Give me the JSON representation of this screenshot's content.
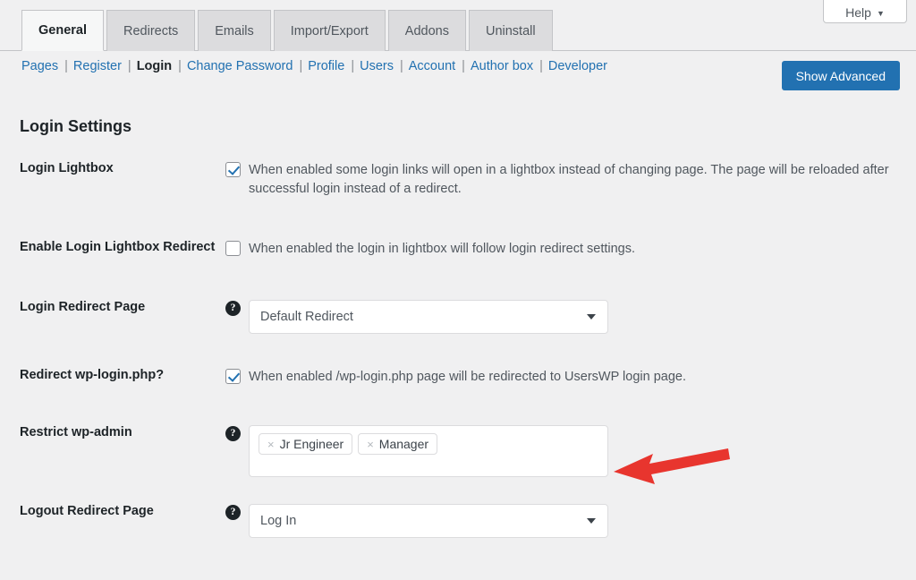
{
  "header": {
    "help_button": {
      "label": "Help",
      "caret": "▼"
    },
    "tabs": [
      {
        "label": "General",
        "active": true
      },
      {
        "label": "Redirects",
        "active": false
      },
      {
        "label": "Emails",
        "active": false
      },
      {
        "label": "Import/Export",
        "active": false
      },
      {
        "label": "Addons",
        "active": false
      },
      {
        "label": "Uninstall",
        "active": false
      }
    ],
    "subnav": [
      {
        "label": "Pages",
        "current": false
      },
      {
        "label": "Register",
        "current": false
      },
      {
        "label": "Login",
        "current": true
      },
      {
        "label": "Change Password",
        "current": false
      },
      {
        "label": "Profile",
        "current": false
      },
      {
        "label": "Users",
        "current": false
      },
      {
        "label": "Account",
        "current": false
      },
      {
        "label": "Author box",
        "current": false
      },
      {
        "label": "Developer",
        "current": false
      }
    ],
    "show_advanced_label": "Show Advanced"
  },
  "section": {
    "title": "Login Settings"
  },
  "rows": {
    "login_lightbox": {
      "label": "Login Lightbox",
      "checkbox_text": "When enabled some login links will open in a lightbox instead of changing page. The page will be reloaded after successful login instead of a redirect.",
      "checked": true
    },
    "enable_login_lightbox_redirect": {
      "label": "Enable Login Lightbox Redirect",
      "checkbox_text": "When enabled the login in lightbox will follow login redirect settings.",
      "checked": false
    },
    "login_redirect_page": {
      "label": "Login Redirect Page",
      "help_icon": "question-mark-icon",
      "value": "Default Redirect"
    },
    "redirect_wp_login": {
      "label": "Redirect wp-login.php?",
      "checkbox_text": "When enabled /wp-login.php page will be redirected to UsersWP login page.",
      "checked": true
    },
    "restrict_wp_admin": {
      "label": "Restrict wp-admin",
      "help_icon": "question-mark-icon",
      "tags": [
        {
          "remove": "×",
          "label": "Jr Engineer"
        },
        {
          "remove": "×",
          "label": "Manager"
        }
      ]
    },
    "logout_redirect_page": {
      "label": "Logout Redirect Page",
      "help_icon": "question-mark-icon",
      "value": "Log In"
    }
  },
  "annotation": {
    "arrow_color": "#e8352e",
    "direction": "left"
  },
  "colors": {
    "accent_blue": "#2271b1",
    "page_bg": "#f0f0f1",
    "tab_inactive": "#dcdcde",
    "tab_active": "#f6f7f7",
    "border": "#c3c4c7"
  }
}
